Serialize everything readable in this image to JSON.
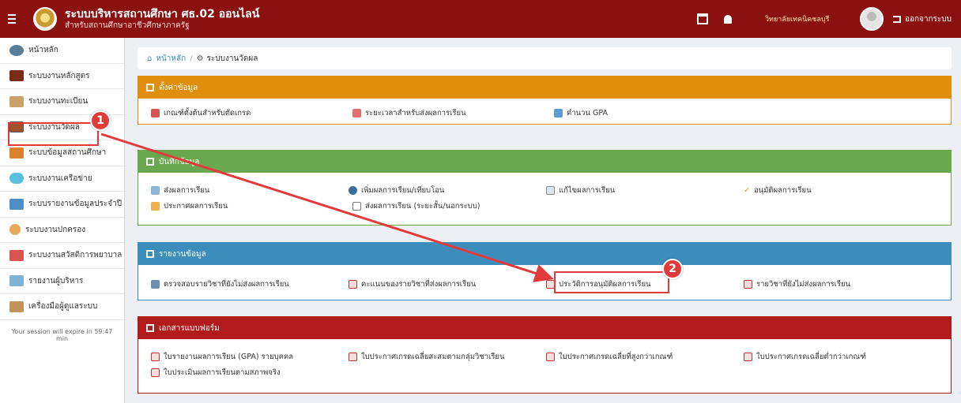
{
  "header": {
    "title": "ระบบบริหารสถานศึกษา ศธ.02 ออนไลน์",
    "subtitle": "สำหรับสถานศึกษาอาชีวศึกษาภาครัฐ",
    "institution": "วิทยาลัยเทคนิคชลบุรี",
    "logout_label": "ออกจากระบบ",
    "brand_color": "#8b1010"
  },
  "sidebar": {
    "items": [
      {
        "label": "หน้าหลัก",
        "icon": "home-icon"
      },
      {
        "label": "ระบบงานหลักสูตร",
        "icon": "book-icon"
      },
      {
        "label": "ระบบงานทะเบียน",
        "icon": "students-icon"
      },
      {
        "label": "ระบบงานวัดผล",
        "icon": "clipboard-icon"
      },
      {
        "label": "ระบบข้อมูลสถานศึกษา",
        "icon": "school-icon"
      },
      {
        "label": "ระบบงานเครือข่าย",
        "icon": "cloud-icon"
      },
      {
        "label": "ระบบรายงานข้อมูลประจำปี",
        "icon": "report-icon"
      },
      {
        "label": "ระบบงานปกครอง",
        "icon": "person-icon"
      },
      {
        "label": "ระบบงานสวัสดิการพยาบาล",
        "icon": "medkit-icon"
      },
      {
        "label": "รายงานผู้บริหาร",
        "icon": "chart-icon"
      },
      {
        "label": "เครื่องมือผู้ดูแลระบบ",
        "icon": "users-icon"
      }
    ],
    "session_text": "Your session will expire in 59:47 min"
  },
  "breadcrumb": {
    "home": "หน้าหลัก",
    "current": "ระบบงานวัดผล"
  },
  "panels": {
    "settings": {
      "title": "ตั้งค่าข้อมูล",
      "items": [
        "เกณฑ์ตั้งต้นสำหรับตัดเกรด",
        "ระยะเวลาสำหรับส่งผลการเรียน",
        "คำนวน GPA"
      ]
    },
    "record": {
      "title": "บันทึกข้อมูล",
      "row1": [
        "ส่งผลการเรียน",
        "เพิ่มผลการเรียน/เทียบโอน",
        "แก้ไขผลการเรียน",
        "อนุมัติผลการเรียน"
      ],
      "row2": [
        "ประกาศผลการเรียน",
        "ส่งผลการเรียน (ระยะสั้น/นอกระบบ)"
      ]
    },
    "reports": {
      "title": "รายงานข้อมูล",
      "items": [
        "ตรวจสอบรายวิชาที่ยังไม่ส่งผลการเรียน",
        "คะแนนของรายวิชาที่ส่งผลการเรียน",
        "ประวัติการอนุมัติผลการเรียน",
        "รายวิชาที่ยังไม่ส่งผลการเรียน"
      ]
    },
    "forms": {
      "title": "เอกสารแบบฟอร์ม",
      "row1": [
        "ใบรายงานผลการเรียน (GPA) รายบุคคล",
        "ใบประกาศเกรดเฉลี่ยสะสมตามกลุ่มวิชาเรียน",
        "ใบประกาศเกรดเฉลี่ยที่สูงกว่าเกณฑ์",
        "ใบประกาศเกรดเฉลี่ยต่ำกว่าเกณฑ์"
      ],
      "row2": [
        "ใบประเมินผลการเรียนตามสภาพจริง"
      ]
    }
  },
  "callouts": {
    "first": "1",
    "second": "2"
  },
  "colors": {
    "settings": "#e08e0b",
    "record": "#6aa84f",
    "reports": "#3c8dbc",
    "forms": "#b21b1b",
    "annotation": "#e23a3a"
  }
}
